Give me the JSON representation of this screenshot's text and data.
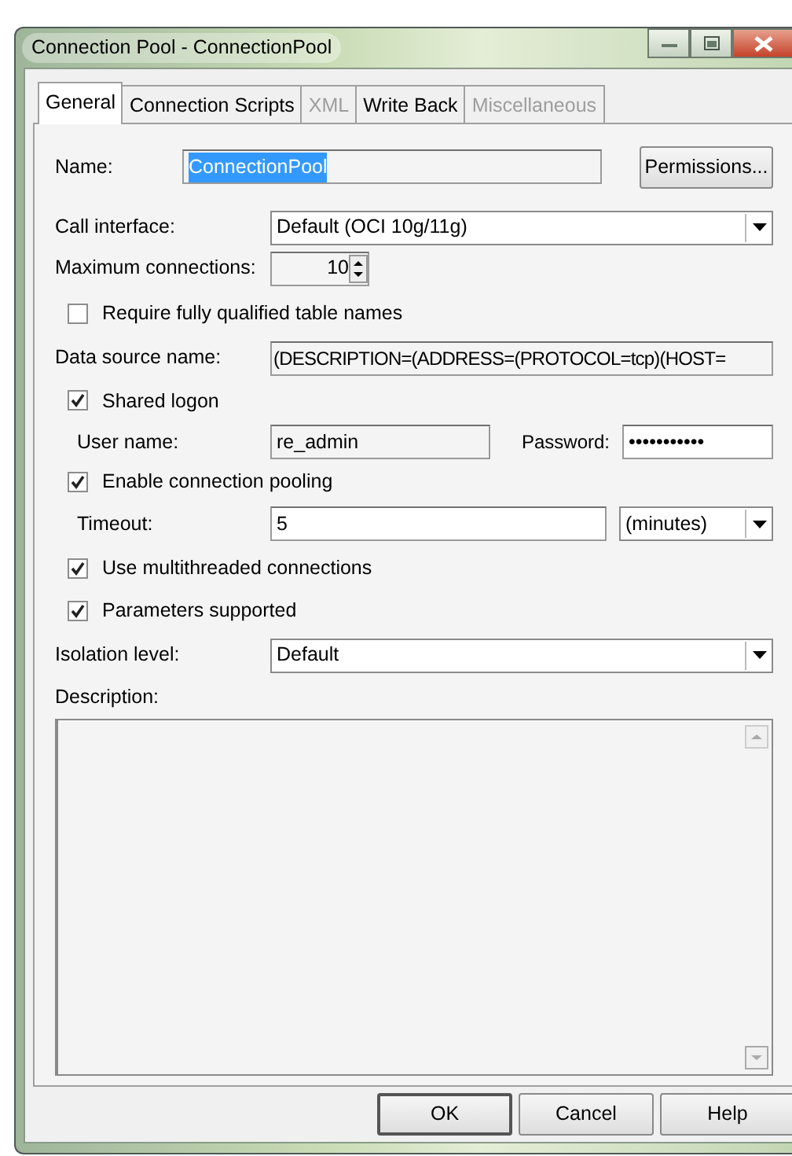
{
  "window": {
    "title": "Connection Pool - ConnectionPool"
  },
  "tabs": [
    {
      "label": "General",
      "selected": true,
      "disabled": false
    },
    {
      "label": "Connection Scripts",
      "selected": false,
      "disabled": false
    },
    {
      "label": "XML",
      "selected": false,
      "disabled": true
    },
    {
      "label": "Write Back",
      "selected": false,
      "disabled": false
    },
    {
      "label": "Miscellaneous",
      "selected": false,
      "disabled": true
    }
  ],
  "name": {
    "label": "Name:",
    "value": "ConnectionPool",
    "highlighted": true
  },
  "permissions_button": "Permissions...",
  "call_interface": {
    "label": "Call interface:",
    "value": "Default (OCI 10g/11g)"
  },
  "maximum_connections": {
    "label": "Maximum connections:",
    "value": "10"
  },
  "require_qualified_names": {
    "label": "Require fully qualified table names",
    "checked": false
  },
  "data_source_name": {
    "label": "Data source name:",
    "value": "(DESCRIPTION=(ADDRESS=(PROTOCOL=tcp)(HOST="
  },
  "shared_logon": {
    "label": "Shared logon",
    "checked": true
  },
  "user_name": {
    "label": "User name:",
    "value": "re_admin"
  },
  "password": {
    "label": "Password:",
    "value": "•••••••••••"
  },
  "connection_pooling": {
    "label": "Enable connection pooling",
    "checked": true
  },
  "timeout": {
    "label": "Timeout:",
    "value": "5",
    "unit": "(minutes)"
  },
  "multithreaded": {
    "label": "Use multithreaded connections",
    "checked": true
  },
  "parameters_supported": {
    "label": "Parameters supported",
    "checked": true
  },
  "isolation_level": {
    "label": "Isolation level:",
    "value": "Default"
  },
  "description": {
    "label": "Description:"
  },
  "buttons": [
    {
      "label": "OK",
      "default": true
    },
    {
      "label": "Cancel",
      "default": false
    },
    {
      "label": "Help",
      "default": false
    }
  ]
}
